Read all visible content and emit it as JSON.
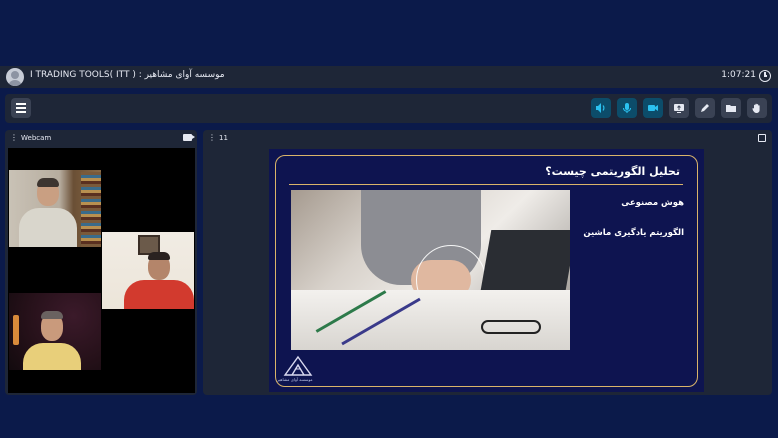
{
  "header": {
    "meeting_title": "I TRADING TOOLS( ITT ) : موسسه آوای مشاهیر",
    "elapsed_time": "1:07:21"
  },
  "toolbar": {
    "icons": [
      "menu-icon",
      "speaker-icon",
      "microphone-icon",
      "camera-icon",
      "screen-share-icon",
      "pen-icon",
      "folder-icon",
      "hand-icon"
    ],
    "colors": {
      "active_bg": "#0c4c6a",
      "active_fg": "#2bc1f0",
      "plain_bg": "#3a4254"
    }
  },
  "webcam_panel": {
    "label": "Webcam"
  },
  "presentation_panel": {
    "label": "11",
    "slide": {
      "title": "تحلیل الگوریتمی چیست؟",
      "bullets": [
        "هوش مصنوعی",
        "الگوریتم یادگیری ماشین"
      ],
      "logo_caption": "موسسه آوای مشاهیر"
    }
  },
  "colors": {
    "background": "#0b1a4a",
    "panel": "#1e2637",
    "slide_bg": "#0e1450",
    "slide_accent": "#d9b46a"
  }
}
